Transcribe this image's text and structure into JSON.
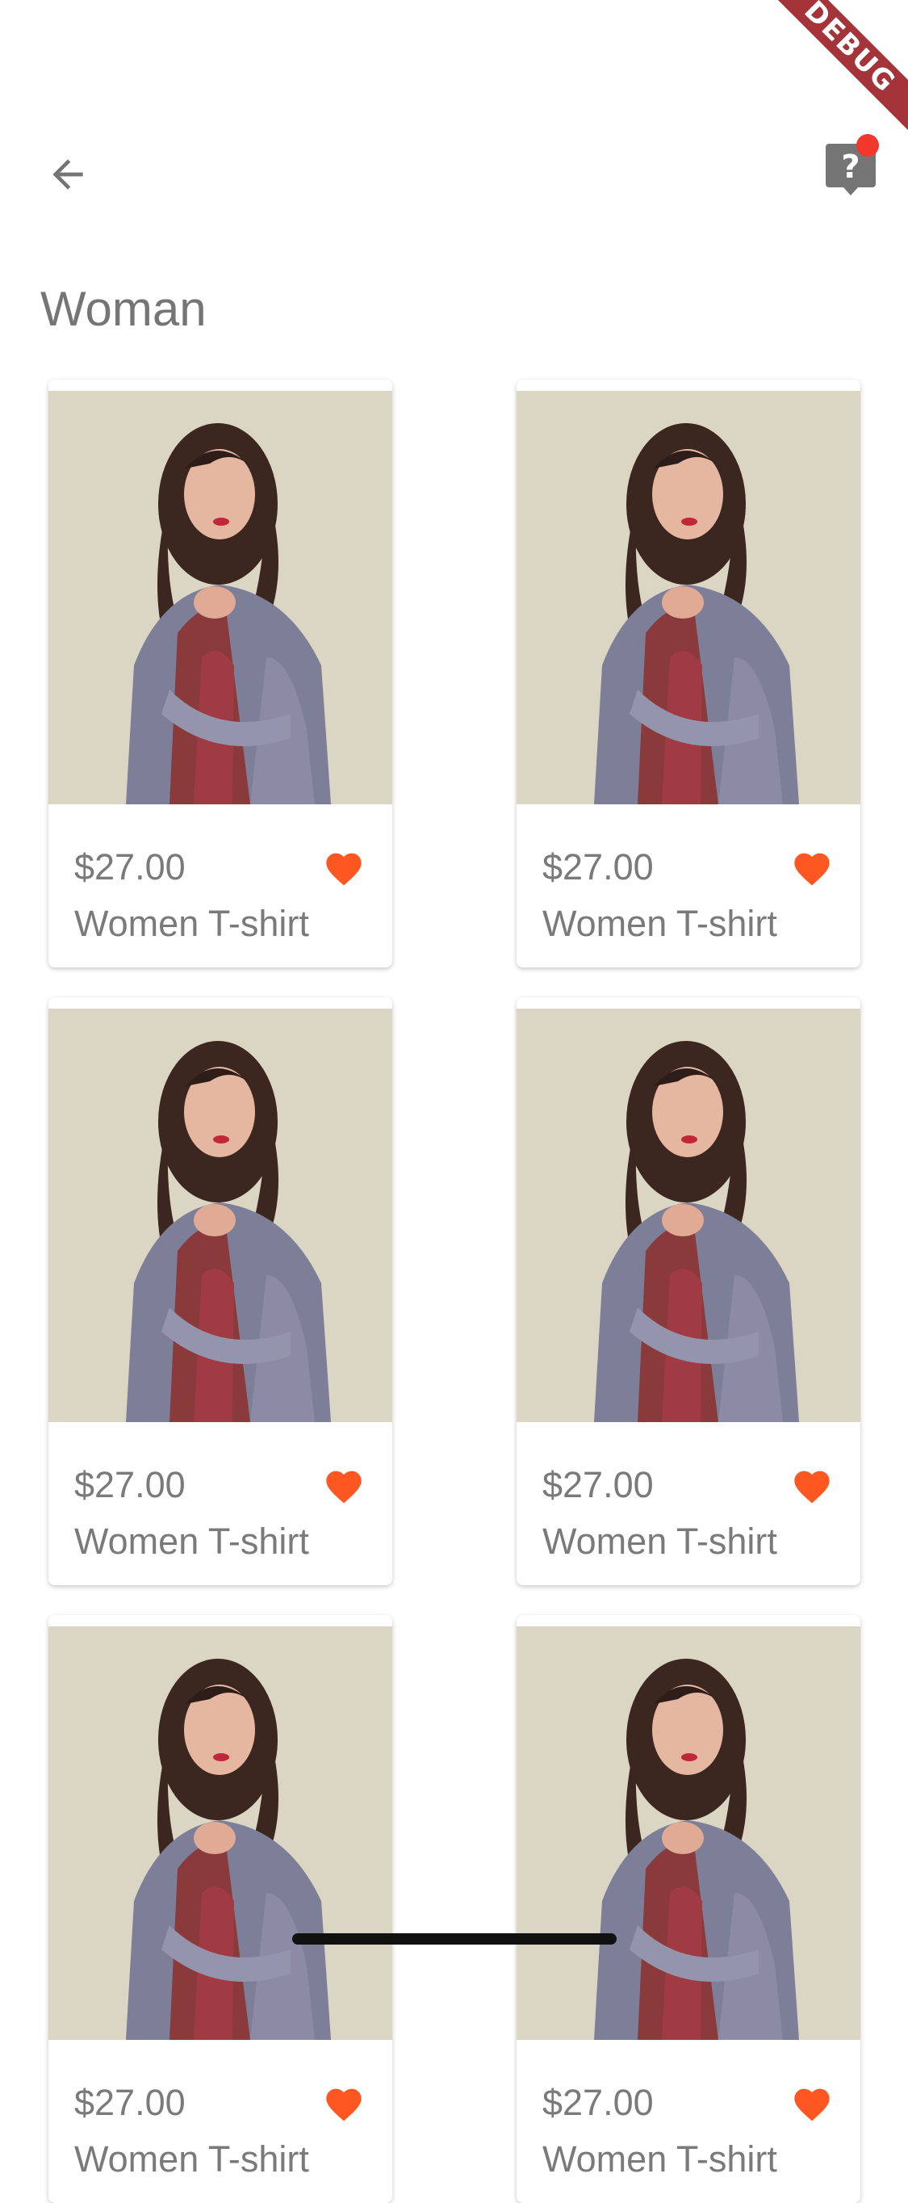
{
  "debug_banner": "DEBUG",
  "page": {
    "title": "Woman"
  },
  "colors": {
    "accent": "#ff5722",
    "badge": "#f4372c",
    "text": "#757575"
  },
  "icons": {
    "back": "arrow-back-icon",
    "help": "help-icon",
    "favorite": "heart-icon"
  },
  "products": [
    {
      "price": "$27.00",
      "title": "Women T-shirt"
    },
    {
      "price": "$27.00",
      "title": "Women T-shirt"
    },
    {
      "price": "$27.00",
      "title": "Women T-shirt"
    },
    {
      "price": "$27.00",
      "title": "Women T-shirt"
    },
    {
      "price": "$27.00",
      "title": "Women T-shirt"
    },
    {
      "price": "$27.00",
      "title": "Women T-shirt"
    }
  ]
}
